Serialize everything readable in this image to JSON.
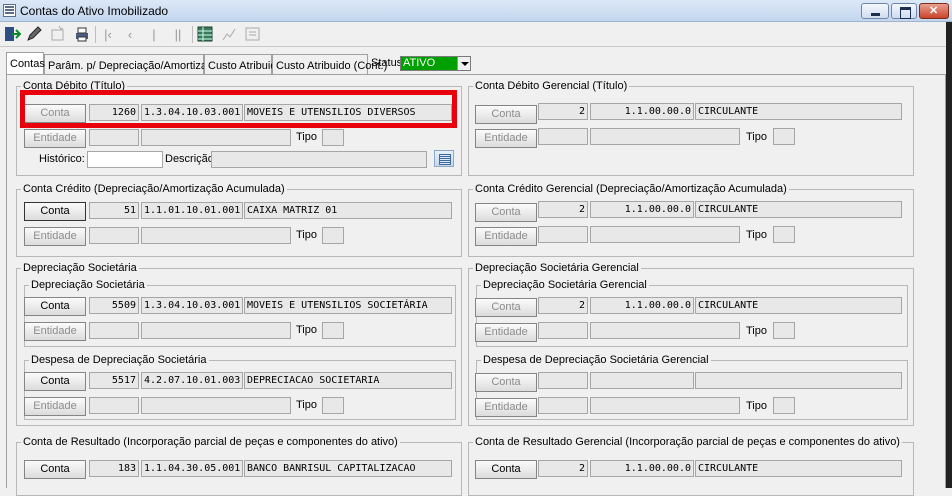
{
  "window": {
    "title": "Contas do Ativo Imobilizado"
  },
  "toolbar": {
    "icons": [
      "exit-icon",
      "edit-icon",
      "new-icon",
      "print-icon",
      "first-icon",
      "prev-icon",
      "next-icon",
      "last-icon",
      "grid-icon",
      "chart-icon",
      "report-icon"
    ]
  },
  "tabs": [
    "Contas",
    "Parâm. p/ Depreciação/Amortização",
    "Custo Atribuido",
    "Custo Atribuido (Cont.)"
  ],
  "status": {
    "label": "Status",
    "value": "ATIVO"
  },
  "labels": {
    "conta": "Conta",
    "entidade": "Entidade",
    "tipo": "Tipo",
    "historico": "Histórico:",
    "descricao": "Descrição:"
  },
  "sections": {
    "debito": {
      "title": "Conta Débito (Título)",
      "num": "1260",
      "code": "1.3.04.10.03.001.0001",
      "desc": "MOVEIS E UTENSILIOS DIVERSOS"
    },
    "debito_ger": {
      "title": "Conta Débito Gerencial (Título)",
      "num": "2",
      "code": "1.1.00.00.0",
      "desc": "CIRCULANTE"
    },
    "credito": {
      "title": "Conta Crédito (Depreciação/Amortização Acumulada)",
      "num": "51",
      "code": "1.1.01.10.01.001.0000",
      "desc": "CAIXA MATRIZ 01"
    },
    "credito_ger": {
      "title": "Conta Crédito Gerencial (Depreciação/Amortização Acumulada)",
      "num": "2",
      "code": "1.1.00.00.0",
      "desc": "CIRCULANTE"
    },
    "dep_soc": {
      "title": "Depreciação Societária"
    },
    "dep_soc_ger": {
      "title": "Depreciação Societária Gerencial"
    },
    "dep_soc_inner": {
      "title": "Depreciação Societária",
      "num": "5509",
      "code": "1.3.04.10.03.001.0004",
      "desc": "MOVEIS E UTENSILIOS SOCIETÁRIA"
    },
    "dep_soc_ger_inner": {
      "title": "Depreciação Societária Gerencial",
      "num": "2",
      "code": "1.1.00.00.0",
      "desc": "CIRCULANTE"
    },
    "desp_soc": {
      "title": "Despesa de Depreciação Societária",
      "num": "5517",
      "code": "4.2.07.10.01.003.0000",
      "desc": "DEPRECIACAO SOCIETARIA"
    },
    "desp_soc_ger": {
      "title": "Despesa de Depreciação Societária Gerencial"
    },
    "resultado": {
      "title": "Conta de Resultado (Incorporação parcial de peças e componentes do ativo)",
      "num": "183",
      "code": "1.1.04.30.05.001.0000",
      "desc": "BANCO BANRISUL CAPITALIZACAO"
    },
    "resultado_ger": {
      "title": "Conta de Resultado Gerencial (Incorporação parcial de peças e componentes do ativo)",
      "num": "2",
      "code": "1.1.00.00.0",
      "desc": "CIRCULANTE"
    }
  }
}
